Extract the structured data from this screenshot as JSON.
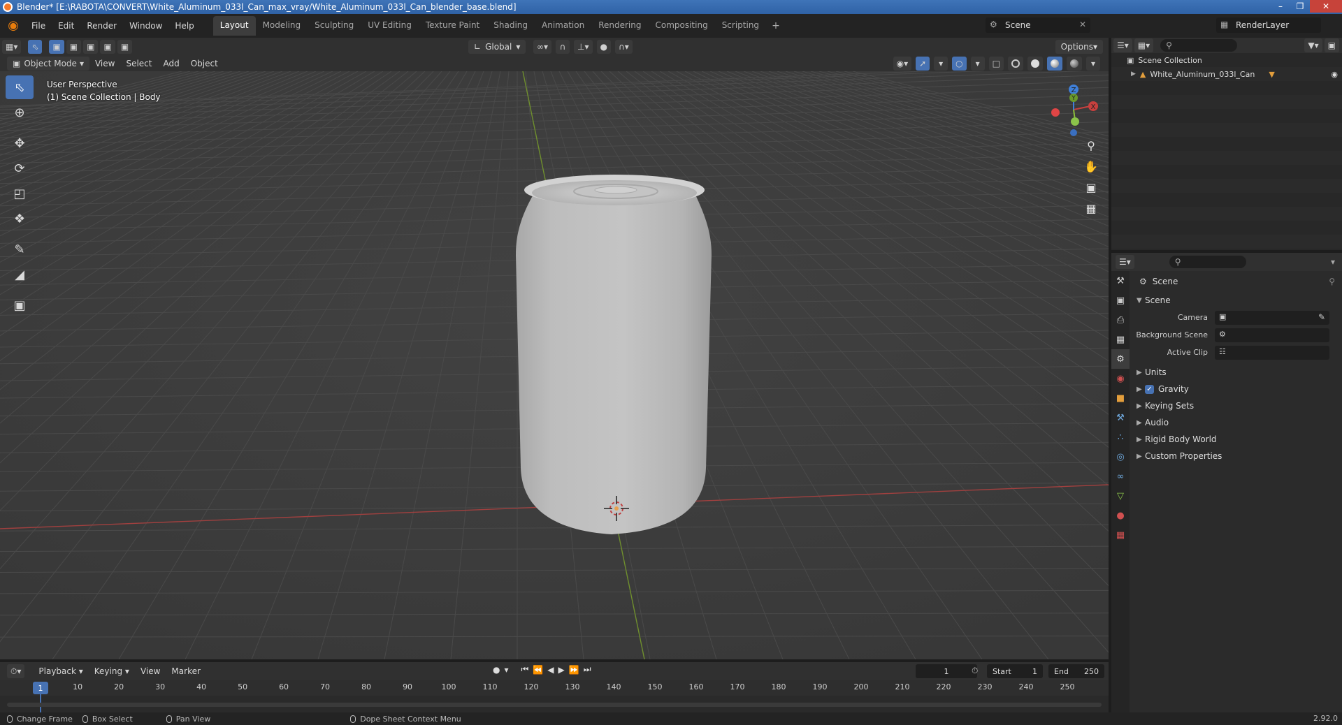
{
  "window": {
    "title": "Blender* [E:\\RABOTA\\CONVERT\\White_Aluminum_033l_Can_max_vray/White_Aluminum_033l_Can_blender_base.blend]"
  },
  "menu": {
    "items": [
      "File",
      "Edit",
      "Render",
      "Window",
      "Help"
    ]
  },
  "workspaces": {
    "tabs": [
      "Layout",
      "Modeling",
      "Sculpting",
      "UV Editing",
      "Texture Paint",
      "Shading",
      "Animation",
      "Rendering",
      "Compositing",
      "Scripting"
    ],
    "active": "Layout",
    "add": "+"
  },
  "scene_selector": {
    "value": "Scene"
  },
  "view_layer": {
    "value": "RenderLayer"
  },
  "viewport_header": {
    "mode": "Object Mode",
    "menus": [
      "View",
      "Select",
      "Add",
      "Object"
    ],
    "transform_orientation": "Global",
    "options": "Options"
  },
  "viewport": {
    "perspective_label": "User Perspective",
    "collection_label": "(1) Scene Collection | Body",
    "gizmo": {
      "x_label": "X",
      "y_label": "Y",
      "z_label": "Z"
    }
  },
  "outliner": {
    "root": "Scene Collection",
    "object": "White_Aluminum_033l_Can"
  },
  "properties": {
    "context_title": "Scene",
    "panel_scene": "Scene",
    "fields": [
      {
        "label": "Camera",
        "value": ""
      },
      {
        "label": "Background Scene",
        "value": ""
      },
      {
        "label": "Active Clip",
        "value": ""
      }
    ],
    "panels": [
      "Units",
      "Gravity",
      "Keying Sets",
      "Audio",
      "Rigid Body World",
      "Custom Properties"
    ],
    "gravity_checked": true
  },
  "timeline": {
    "menus": [
      "Playback",
      "Keying",
      "View",
      "Marker"
    ],
    "current_frame": "1",
    "start_label": "Start",
    "start_value": "1",
    "end_label": "End",
    "end_value": "250",
    "ruler": [
      "10",
      "20",
      "30",
      "40",
      "50",
      "60",
      "70",
      "80",
      "90",
      "100",
      "110",
      "120",
      "130",
      "140",
      "150",
      "160",
      "170",
      "180",
      "190",
      "200",
      "210",
      "220",
      "230",
      "240",
      "250"
    ],
    "ruler_current": "1"
  },
  "statusbar": {
    "items": [
      "Change Frame",
      "Box Select",
      "Pan View",
      "Dope Sheet Context Menu"
    ],
    "version": "2.92.0"
  },
  "colors": {
    "accent": "#4772b3",
    "x_axis": "#c8403e",
    "y_axis": "#8bbf3a",
    "z_axis": "#3f7fd8"
  }
}
